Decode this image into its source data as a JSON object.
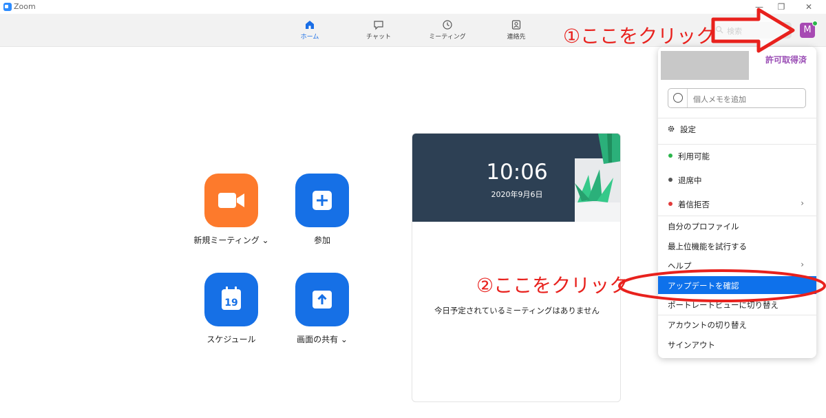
{
  "window": {
    "title": "Zoom",
    "controls": [
      "—",
      "❐",
      "✕"
    ]
  },
  "nav": {
    "tabs": [
      {
        "label": "ホーム",
        "icon": "home-icon",
        "active": true
      },
      {
        "label": "チャット",
        "icon": "chat-icon",
        "active": false
      },
      {
        "label": "ミーティング",
        "icon": "clock-icon",
        "active": false
      },
      {
        "label": "連絡先",
        "icon": "contacts-icon",
        "active": false
      }
    ],
    "search_label": "検索",
    "avatar_initial": "M"
  },
  "actions": [
    {
      "label": "新規ミーティング ⌄",
      "icon": "video-camera-icon",
      "color": "#fd7a2c"
    },
    {
      "label": "参加",
      "icon": "plus-icon",
      "color": "#1670e6"
    },
    {
      "label": "スケジュール",
      "icon": "calendar-icon",
      "color": "#1670e6",
      "day": "19"
    },
    {
      "label": "画面の共有 ⌄",
      "icon": "share-screen-icon",
      "color": "#1670e6"
    }
  ],
  "calendar": {
    "time": "10:06",
    "date": "2020年9月6日",
    "empty_message": "今日予定されているミーティングはありません"
  },
  "profile_menu": {
    "license": "許可取得済",
    "note_placeholder": "個人メモを追加",
    "settings": "設定",
    "statuses": [
      {
        "label": "利用可能",
        "color": "#2bb54b"
      },
      {
        "label": "退席中",
        "color": "#555555"
      },
      {
        "label": "着信拒否",
        "color": "#e23b3b"
      }
    ],
    "items": [
      "自分のプロファイル",
      "最上位機能を試行する",
      "ヘルプ",
      "アップデートを確認",
      "ポートレートビューに切り替え",
      "アカウントの切り替え",
      "サインアウト"
    ]
  },
  "annotations": {
    "step1": "①ここをクリック",
    "step2": "②ここをクリック"
  },
  "colors": {
    "accent": "#0e71eb",
    "annotation_red": "#e8211d"
  }
}
